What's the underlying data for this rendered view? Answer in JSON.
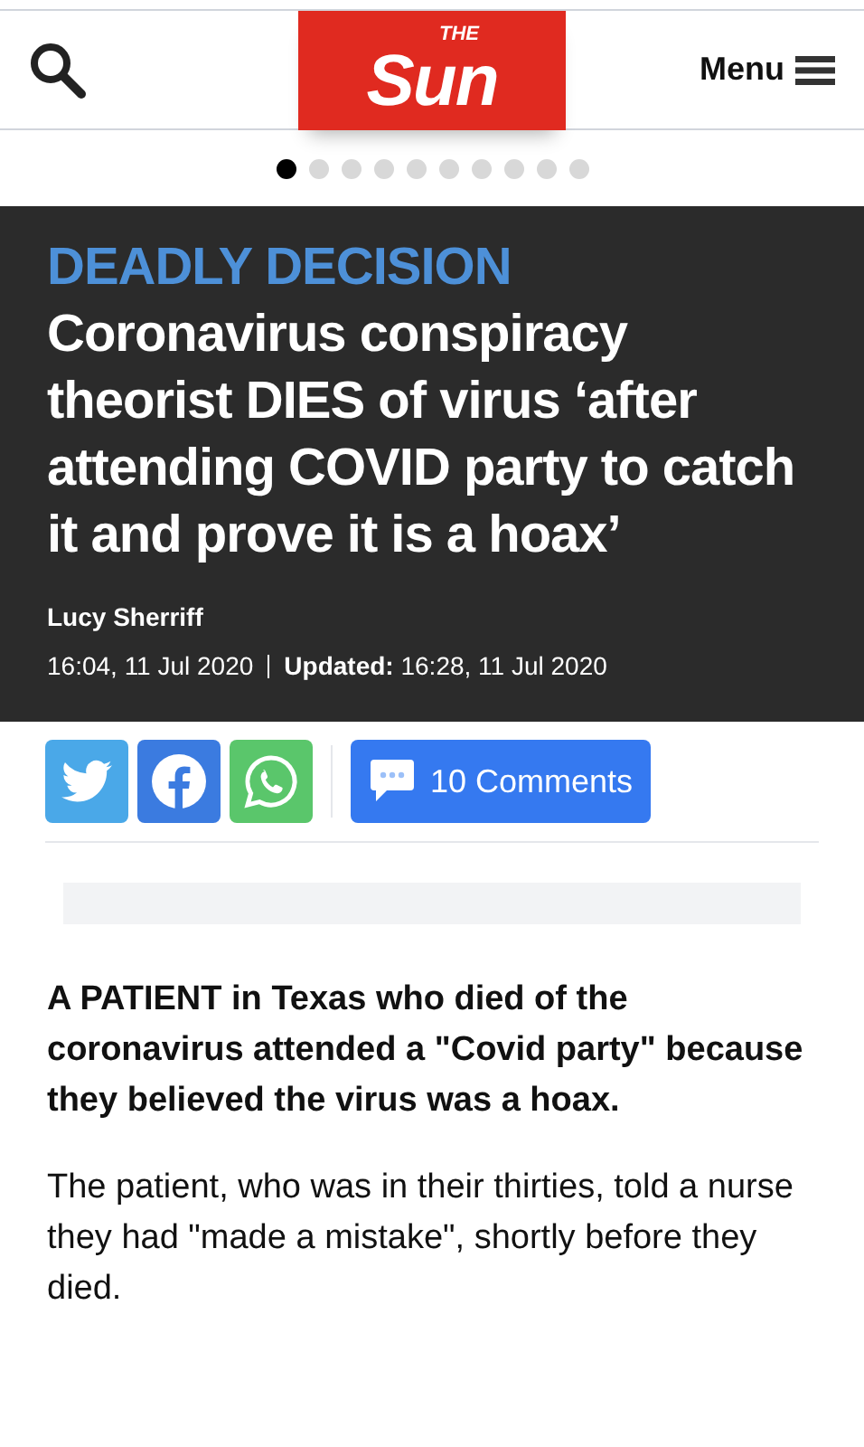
{
  "header": {
    "logo_small": "THE",
    "logo": "Sun",
    "menu": "Menu"
  },
  "carousel_dots": [
    {
      "selected": true
    },
    {
      "selected": false
    },
    {
      "selected": false
    },
    {
      "selected": false
    },
    {
      "selected": false
    },
    {
      "selected": false
    },
    {
      "selected": false
    },
    {
      "selected": false
    },
    {
      "selected": false
    },
    {
      "selected": false
    }
  ],
  "article": {
    "kicker": "DEADLY DECISION",
    "headline": "Coronavirus conspiracy theorist DIES of virus ‘after attending COVID party to catch it and prove it is a hoax’",
    "author": "Lucy Sherriff",
    "published": "16:04, 11 Jul 2020",
    "updated_label": "Updated:",
    "updated": "16:28, 11 Jul 2020"
  },
  "share": {
    "comments": "10 Comments"
  },
  "body": [
    "A PATIENT in Texas who died of the coronavirus attended a \"Covid party\" because they believed the virus was a hoax.",
    "The patient, who was in their thirties, told a nurse they had \"made a mistake\", shortly before they died."
  ]
}
